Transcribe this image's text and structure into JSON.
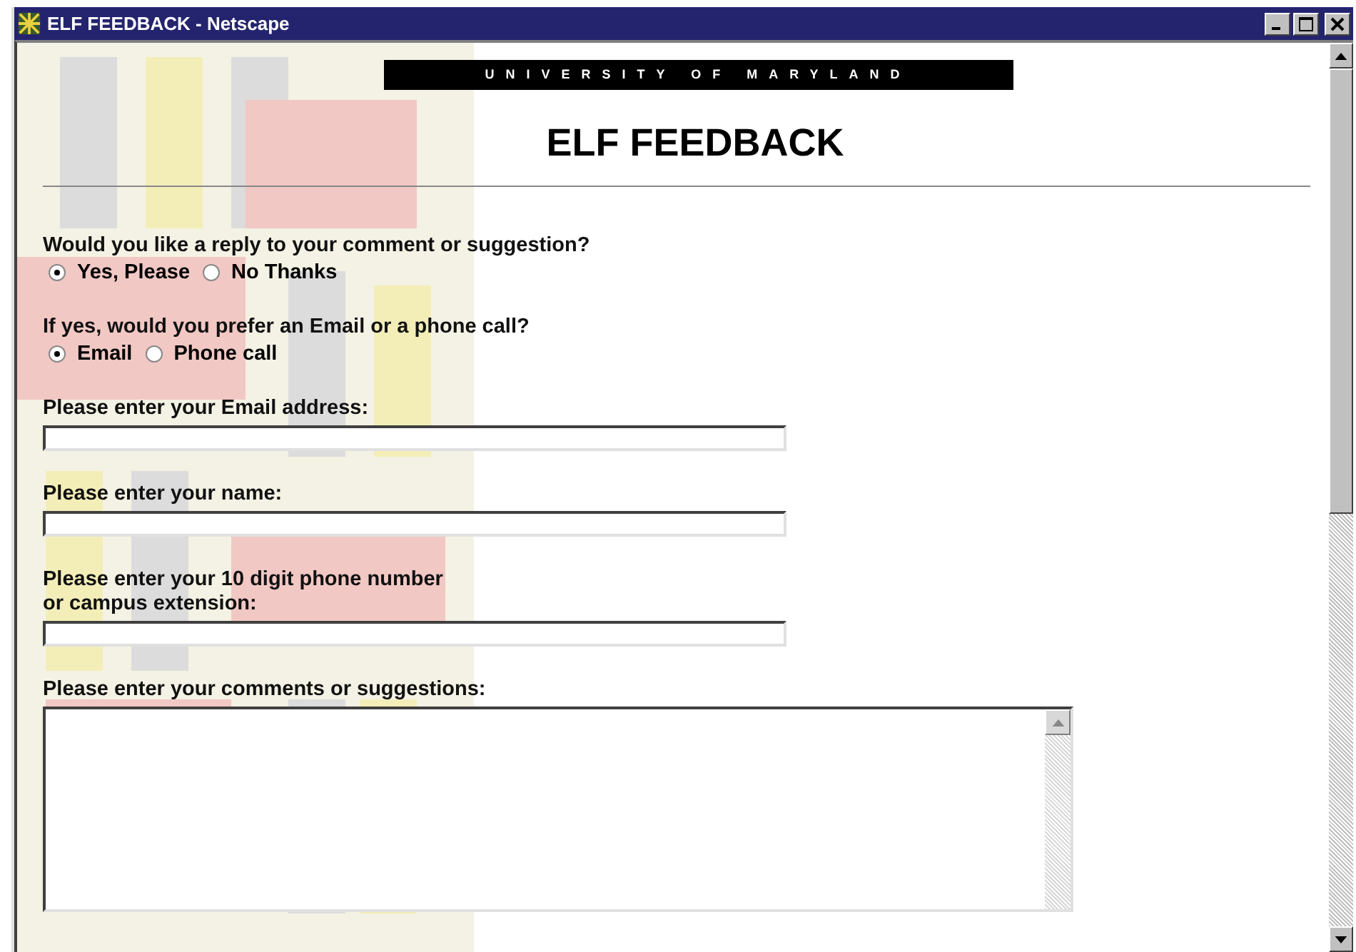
{
  "window": {
    "title": "ELF FEEDBACK - Netscape"
  },
  "banner": "UNIVERSITY OF MARYLAND",
  "heading": "ELF FEEDBACK",
  "questions": [
    {
      "label": "Would you like a reply to your comment or suggestion?",
      "options": [
        {
          "label": "Yes, Please",
          "selected": true
        },
        {
          "label": "No Thanks",
          "selected": false
        }
      ]
    },
    {
      "label": "If yes, would you prefer an Email or a phone call?",
      "options": [
        {
          "label": "Email",
          "selected": true
        },
        {
          "label": "Phone call",
          "selected": false
        }
      ]
    }
  ],
  "fields": [
    {
      "kind": "text",
      "label": "Please enter your Email address:"
    },
    {
      "kind": "text",
      "label": "Please enter your name:"
    },
    {
      "kind": "text",
      "label": "Please enter your 10 digit phone number\nor campus extension:"
    },
    {
      "kind": "textarea",
      "label": "Please enter your comments or suggestions:"
    }
  ]
}
